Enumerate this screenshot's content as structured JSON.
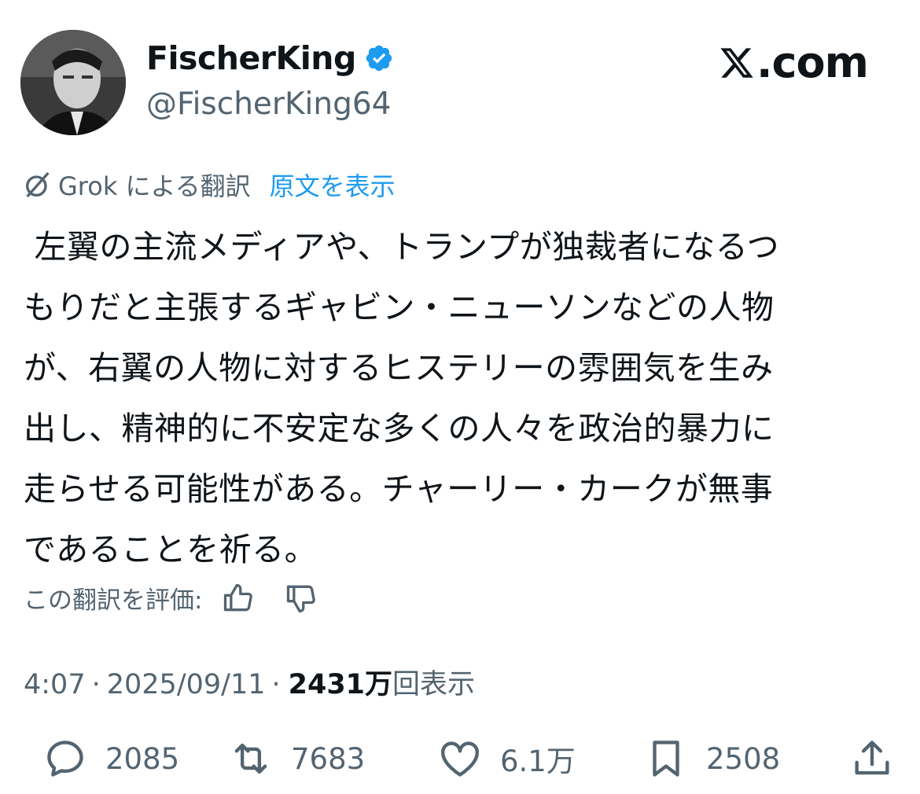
{
  "author": {
    "display_name": "FischerKing",
    "handle": "@FischerKing64",
    "verified": true
  },
  "source_logo": "X.com",
  "translation": {
    "by_label": "Grok による翻訳",
    "show_original": "原文を表示"
  },
  "tweet_text": " 左翼の主流メディアや、トランプが独裁者になるつ\nもりだと主張するギャビン・ニューソンなどの人物\nが、右翼の人物に対するヒステリーの雰囲気を生み\n出し、精神的に不安定な多くの人々を政治的暴力に\n走らせる可能性がある。チャーリー・カークが無事\nであることを祈る。",
  "rating": {
    "label": "この翻訳を評価:"
  },
  "meta": {
    "time": "4:07",
    "separator": "·",
    "date": "2025/09/11",
    "views_count": "2431万",
    "views_label": "回表示"
  },
  "actions": {
    "replies": "2085",
    "reposts": "7683",
    "likes": "6.1万",
    "bookmarks": "2508"
  },
  "colors": {
    "link": "#1d9bf0",
    "secondary_text": "#536471",
    "primary_text": "#0f1419"
  },
  "icons": [
    "verified-badge-icon",
    "x-logo-icon",
    "grok-icon",
    "thumbs-up-icon",
    "thumbs-down-icon",
    "reply-icon",
    "repost-icon",
    "like-icon",
    "bookmark-icon",
    "share-icon"
  ]
}
